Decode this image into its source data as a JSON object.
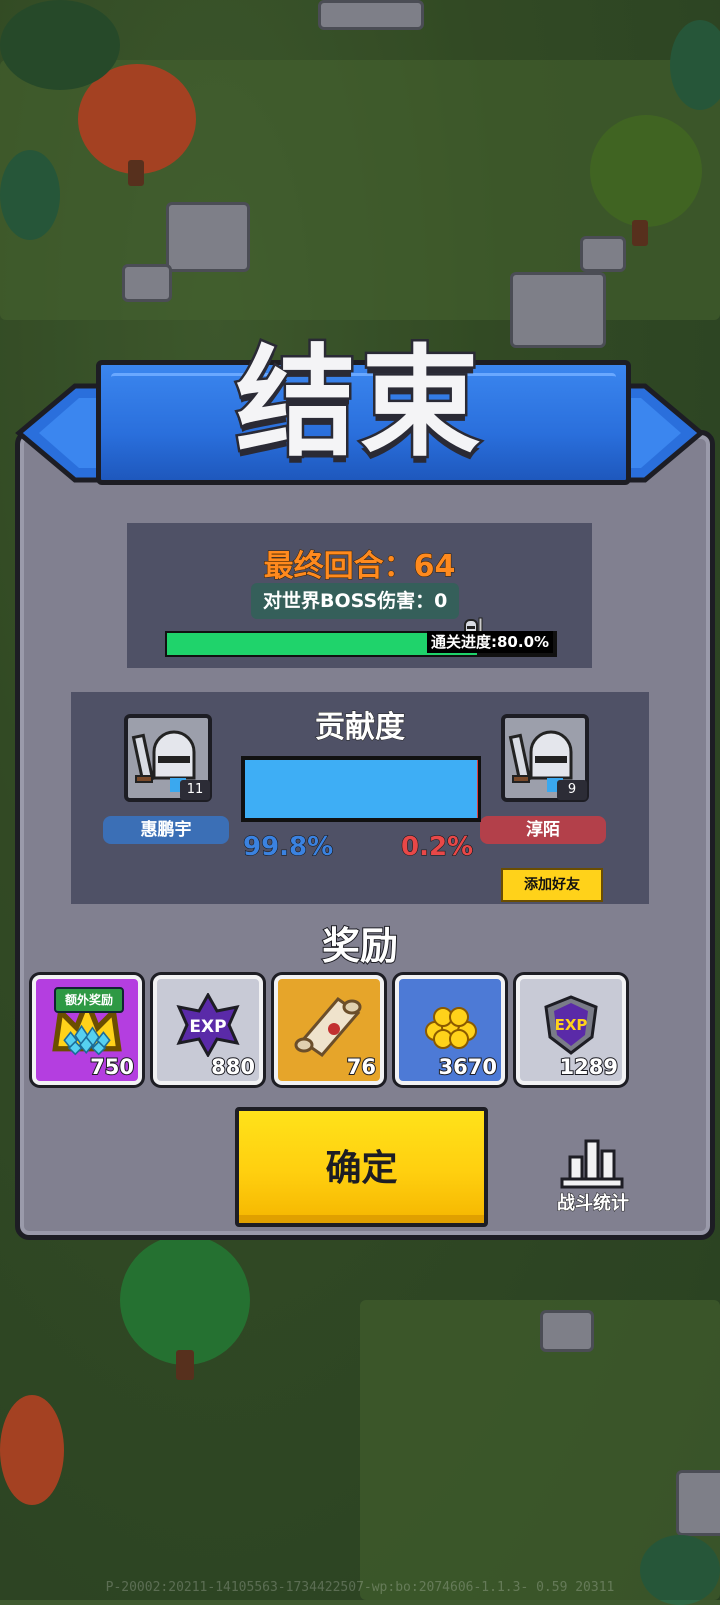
{
  "header": {
    "title": "结束"
  },
  "summary": {
    "final_round": "最终回合：64",
    "boss_damage": "对世界BOSS伤害：0",
    "progress_label": "通关进度:80.0%",
    "progress_fraction": 0.8
  },
  "contribution": {
    "title": "贡献度",
    "left_player": {
      "name": "惠鹏宇",
      "level": "11",
      "percent": "99.8%"
    },
    "right_player": {
      "name": "淳陌",
      "level": "9",
      "percent": "0.2%"
    },
    "left_fraction": 0.998,
    "add_friend_label": "添加好友"
  },
  "rewards": {
    "title": "奖励",
    "bonus_label": "额外奖励",
    "items": [
      {
        "icon": "diamond-pile-icon",
        "amount": "750",
        "bg": "#b43ee0"
      },
      {
        "icon": "exp-star-icon",
        "amount": "880",
        "bg": "#c8cad6"
      },
      {
        "icon": "scroll-icon",
        "amount": "76",
        "bg": "#e6a52a"
      },
      {
        "icon": "gold-coins-icon",
        "amount": "3670",
        "bg": "#4d7ad6"
      },
      {
        "icon": "exp-shield-icon",
        "amount": "1289",
        "bg": "#c8cad6"
      }
    ]
  },
  "actions": {
    "confirm_label": "确定",
    "stats_label": "战斗统计"
  },
  "footer": {
    "version": "P-20002:20211-14105563-1734422507-wp:bo:2074606-1.1.3- 0.59 20311"
  }
}
